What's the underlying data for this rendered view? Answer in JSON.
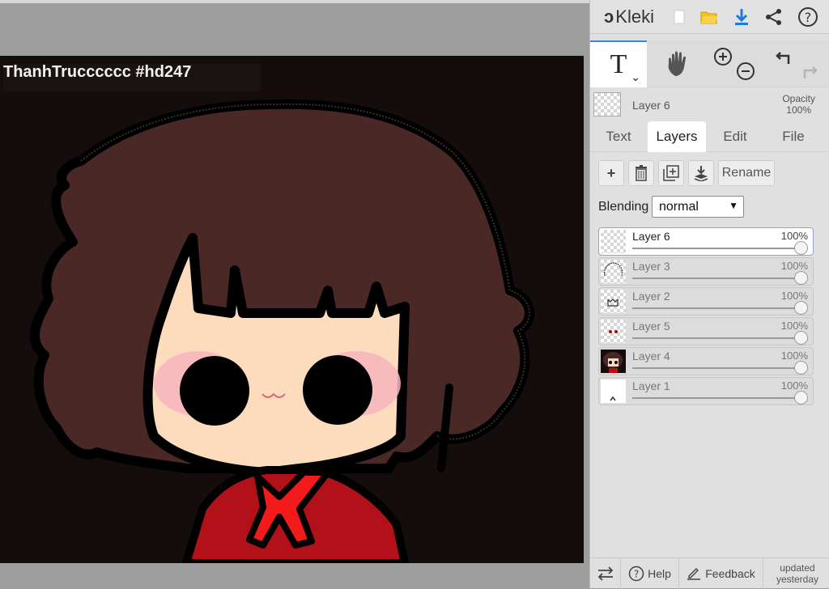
{
  "canvas": {
    "title": "ThanhTrucccccc #hd247"
  },
  "app": {
    "name": "Kleki",
    "logo_icon": "kleki-logo-icon",
    "new_icon": "new-file-icon",
    "open_icon": "folder-open-icon",
    "save_icon": "download-icon",
    "share_icon": "share-icon",
    "help_icon": "help-circle-icon"
  },
  "tools": {
    "text_tool_glyph": "T",
    "hand_icon": "hand-icon",
    "zoom_in_icon": "zoom-in-icon",
    "zoom_out_icon": "zoom-out-icon",
    "undo_icon": "undo-icon",
    "redo_icon": "redo-icon"
  },
  "current_layer": {
    "name": "Layer 6",
    "opacity_label": "Opacity",
    "opacity_value": "100%"
  },
  "tabs": [
    {
      "label": "Text"
    },
    {
      "label": "Layers"
    },
    {
      "label": "Edit"
    },
    {
      "label": "File"
    }
  ],
  "layer_toolbar": {
    "rename_label": "Rename"
  },
  "blending": {
    "label": "Blending",
    "value": "normal"
  },
  "layers": [
    {
      "name": "Layer 6",
      "opacity": "100%"
    },
    {
      "name": "Layer 3",
      "opacity": "100%"
    },
    {
      "name": "Layer 2",
      "opacity": "100%"
    },
    {
      "name": "Layer 5",
      "opacity": "100%"
    },
    {
      "name": "Layer 4",
      "opacity": "100%"
    },
    {
      "name": "Layer 1",
      "opacity": "100%"
    }
  ],
  "footer": {
    "help_label": "Help",
    "feedback_label": "Feedback",
    "updated_line1": "updated",
    "updated_line2": "yesterday"
  },
  "colors": {
    "accent": "#3b87dd",
    "canvas_bg": "#150d0c",
    "hair": "#4a2826",
    "skin": "#fddcbe",
    "blush": "#f7b5bd",
    "shirt": "#c2141a"
  }
}
